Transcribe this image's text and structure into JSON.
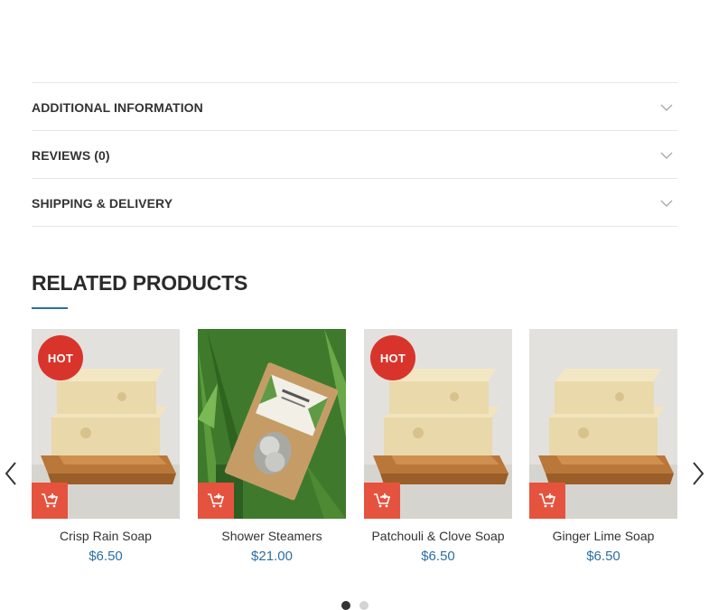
{
  "tabs": [
    {
      "label": "ADDITIONAL INFORMATION"
    },
    {
      "label": "REVIEWS (0)"
    },
    {
      "label": "SHIPPING & DELIVERY"
    }
  ],
  "related": {
    "title": "RELATED PRODUCTS",
    "products": [
      {
        "name": "Crisp Rain Soap",
        "price": "$6.50",
        "badge": "HOT",
        "image": "soap-bars"
      },
      {
        "name": "Shower Steamers",
        "price": "$21.00",
        "badge": "",
        "image": "shower-steamers-bag"
      },
      {
        "name": "Patchouli & Clove Soap",
        "price": "$6.50",
        "badge": "HOT",
        "image": "soap-bars"
      },
      {
        "name": "Ginger Lime Soap",
        "price": "$6.50",
        "badge": "",
        "image": "soap-bars"
      }
    ]
  },
  "carousel": {
    "pages": 2,
    "active_page": 1
  },
  "icons": {
    "accordion": "chevron-down-icon",
    "cart": "add-to-cart-icon",
    "prev": "chevron-left-icon",
    "next": "chevron-right-icon"
  },
  "colors": {
    "accent_blue": "#2b6fa6",
    "hot_badge": "#d9342b",
    "cart_button": "#e5533f"
  }
}
